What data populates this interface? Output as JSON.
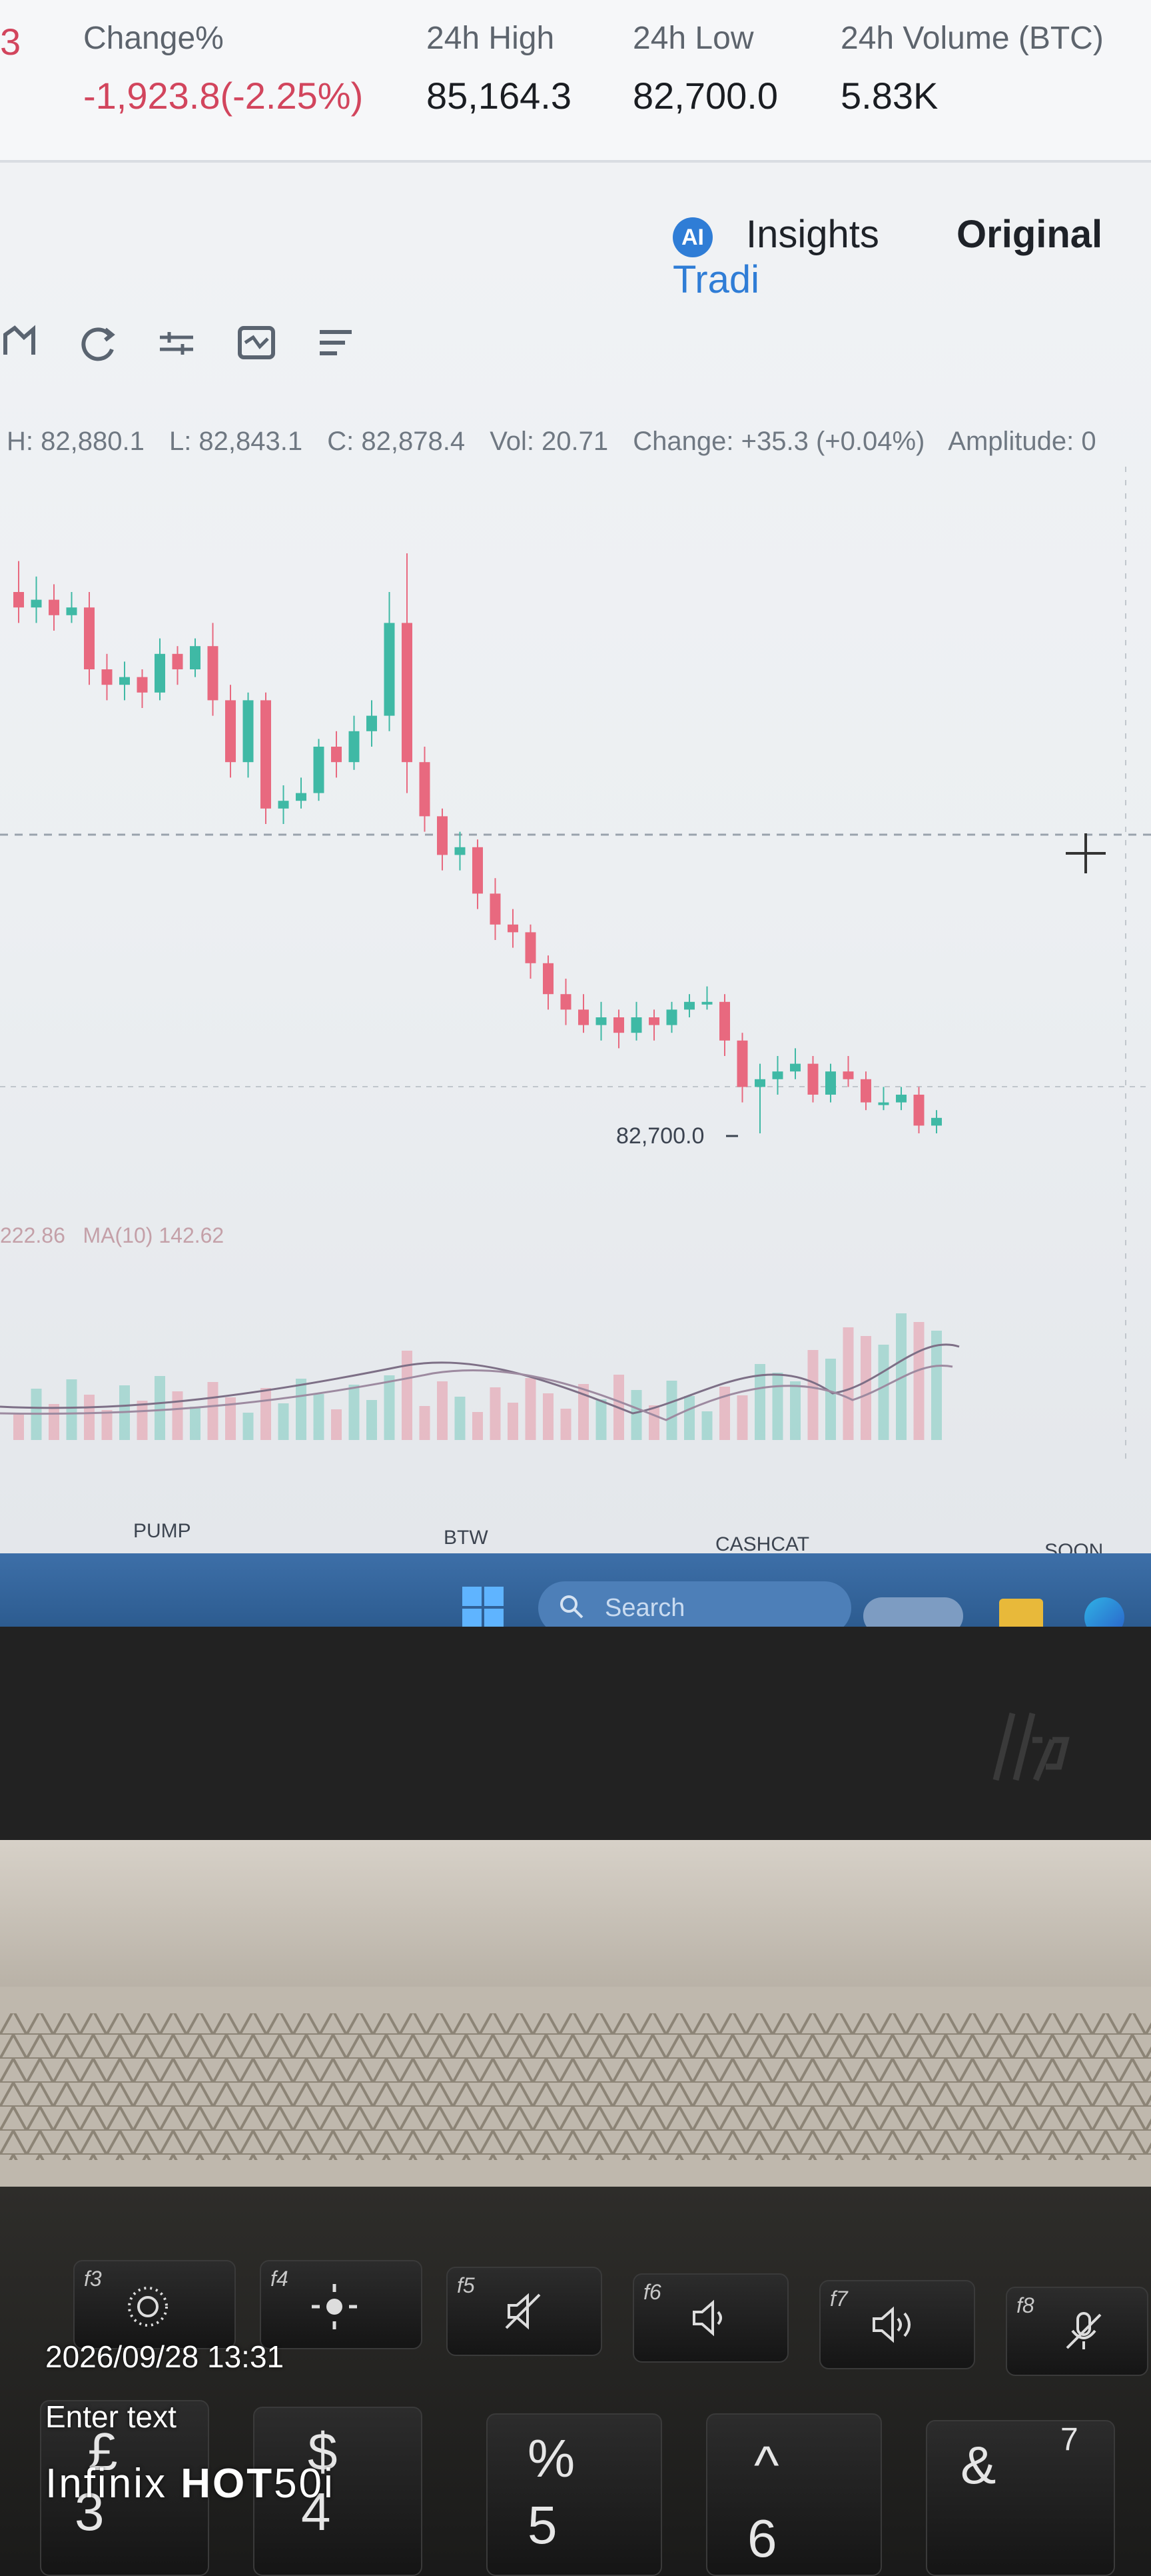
{
  "stats_bar": {
    "partial_prefix": "3",
    "items": [
      {
        "label": "Change%",
        "value": "-1,923.8(-2.25%)"
      },
      {
        "label": "24h High",
        "value": "85,164.3"
      },
      {
        "label": "24h Low",
        "value": "82,700.0"
      },
      {
        "label": "24h Volume (BTC)",
        "value": "5.83K"
      }
    ]
  },
  "tabs": {
    "ai_badge": "AI",
    "insights": "Insights",
    "original": "Original",
    "trading_view_partial": "Tradi"
  },
  "toolbar_icons": [
    "chart-type-icon",
    "refresh-icon",
    "settings-sliders-icon",
    "indicator-icon",
    "list-icon"
  ],
  "ohlc_line": {
    "high": "H: 82,880.1",
    "low": "L: 82,843.1",
    "close": "C: 82,878.4",
    "vol": "Vol: 20.71",
    "change": "Change: +35.3 (+0.04%)",
    "amplitude": "Amplitude: 0"
  },
  "chart": {
    "low_marker": "82,700.0",
    "ma_prefix": "222.86",
    "ma_label": "MA(10) 142.62",
    "colors": {
      "up": "#3fb9a5",
      "down": "#e8697f",
      "bg": "#eef0f3"
    }
  },
  "ticker": [
    "PUMP",
    "BTW",
    "CASHCAT",
    "SOON"
  ],
  "taskbar": {
    "search_placeholder": "Search"
  },
  "keyboard": {
    "fn_keys": [
      "f3",
      "f4",
      "f5",
      "f6",
      "f7",
      "f8"
    ],
    "number_keys": [
      {
        "sym": "£",
        "num": "3"
      },
      {
        "sym": "$",
        "num": "4"
      },
      {
        "sym": "%",
        "num": "5"
      },
      {
        "sym": "^",
        "num": "6"
      },
      {
        "sym": "&",
        "num": "7"
      }
    ]
  },
  "photo_overlay": {
    "timestamp": "2026/09/28 13:31",
    "enter_text": "Enter text",
    "brand_a": "Infinix",
    "brand_b": "HOT",
    "brand_c": "50i"
  },
  "bezel_logo": "hp"
}
